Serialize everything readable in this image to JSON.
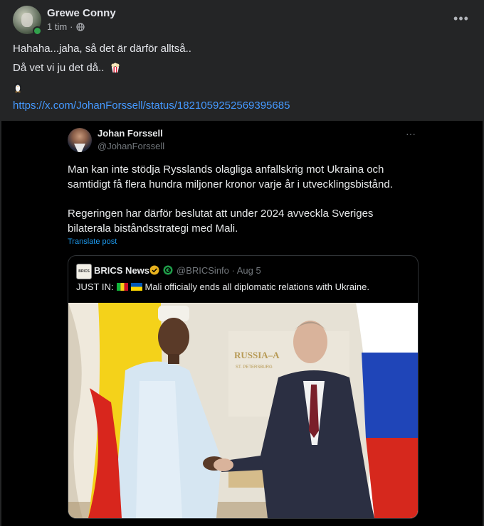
{
  "post": {
    "author": "Grewe Conny",
    "time": "1 tim",
    "meta_sep": "·",
    "more_label": "•••",
    "line1": "Hahaha...jaha, så det är därför alltså..",
    "line2": "Då vet vi ju det då..",
    "link": "https://x.com/JohanForssell/status/1821059252569395685"
  },
  "tweet": {
    "name": "Johan Forssell",
    "handle": "@JohanForssell",
    "more_label": "···",
    "para1": "Man kan inte stödja Rysslands olagliga anfallskrig mot Ukraina och samtidigt få flera hundra miljoner kronor varje år i utvecklingsbistånd.",
    "para2": "Regeringen har därför beslutat att under 2024 avveckla Sveriges bilaterala biståndsstrategi med Mali.",
    "translate": "Translate post"
  },
  "quote": {
    "logo_text": "BRICS",
    "name": "BRICS News",
    "handle_date": "@BRICSinfo · Aug 5",
    "text_prefix": "JUST IN:",
    "text_rest": "Mali officially ends all diplomatic relations with Ukraine.",
    "backdrop_title": "RUSSIA–A",
    "backdrop_sub": "ST. PETERSBURG"
  },
  "colors": {
    "background": "#242526",
    "link": "#4599ff",
    "embed_bg": "#000000",
    "translate": "#1d9bf0",
    "online": "#31a24c"
  },
  "icons": [
    "globe-icon",
    "more-icon",
    "popcorn-icon",
    "penguin-icon",
    "verified-badge-icon",
    "affiliate-badge-icon",
    "mali-flag-icon",
    "ukraine-flag-icon"
  ]
}
